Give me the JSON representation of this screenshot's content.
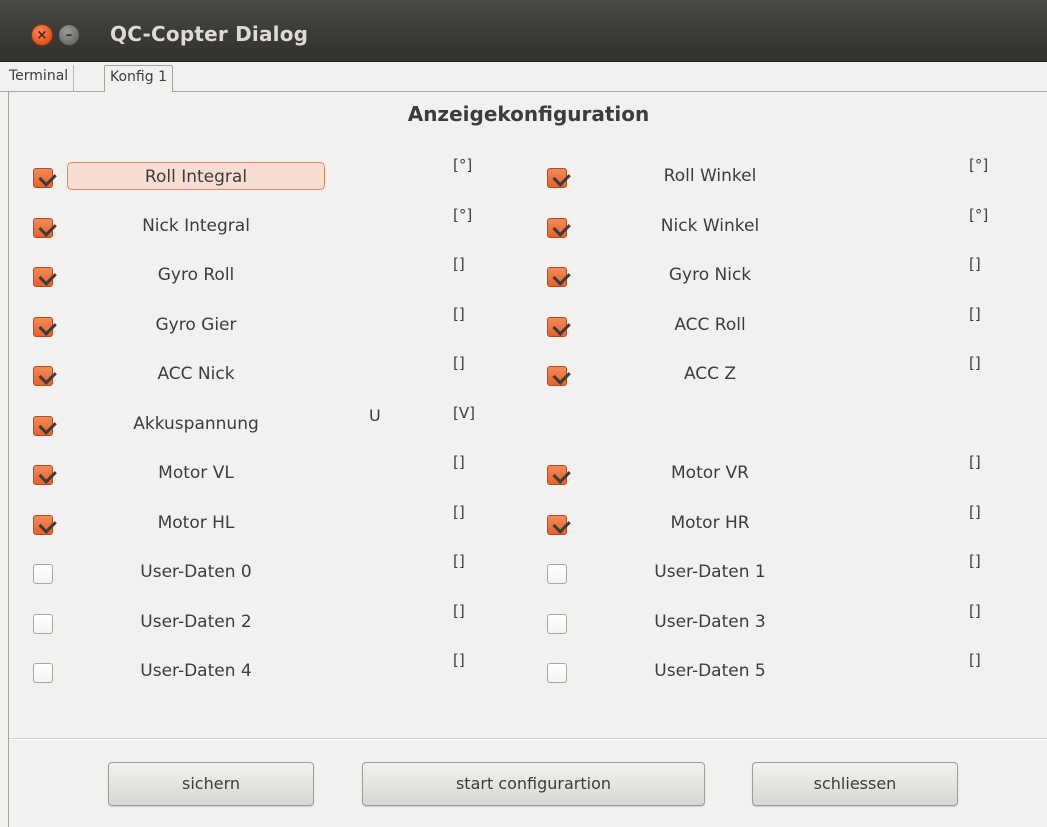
{
  "window": {
    "title": "QC-Copter Dialog"
  },
  "tabs": [
    {
      "label": "Terminal"
    },
    {
      "label": "Konfig 1"
    }
  ],
  "heading": "Anzeigekonfiguration",
  "left_items": [
    {
      "label": "Roll Integral",
      "unit": "[°]",
      "checked": true
    },
    {
      "label": "Nick Integral",
      "unit": "[°]",
      "checked": true
    },
    {
      "label": "Gyro Roll",
      "unit": "[]",
      "checked": true
    },
    {
      "label": "Gyro Gier",
      "unit": "[]",
      "checked": true
    },
    {
      "label": "ACC Nick",
      "unit": "[]",
      "checked": true
    },
    {
      "label": "Akkuspannung",
      "unit": "[V]",
      "value": "U",
      "checked": true
    },
    {
      "label": "Motor VL",
      "unit": "[]",
      "checked": true
    },
    {
      "label": "Motor HL",
      "unit": "[]",
      "checked": true
    },
    {
      "label": "User-Daten 0",
      "unit": "[]",
      "checked": false
    },
    {
      "label": "User-Daten 2",
      "unit": "[]",
      "checked": false
    },
    {
      "label": "User-Daten 4",
      "unit": "[]",
      "checked": false
    }
  ],
  "right_items": [
    {
      "label": "Roll Winkel",
      "unit": "[°]",
      "checked": true
    },
    {
      "label": "Nick Winkel",
      "unit": "[°]",
      "checked": true
    },
    {
      "label": "Gyro Nick",
      "unit": "[]",
      "checked": true
    },
    {
      "label": "ACC Roll",
      "unit": "[]",
      "checked": true
    },
    {
      "label": "ACC Z",
      "unit": "[]",
      "checked": true
    },
    null,
    {
      "label": "Motor VR",
      "unit": "[]",
      "checked": true
    },
    {
      "label": "Motor HR",
      "unit": "[]",
      "checked": true
    },
    {
      "label": "User-Daten 1",
      "unit": "[]",
      "checked": false
    },
    {
      "label": "User-Daten 3",
      "unit": "[]",
      "checked": false
    },
    {
      "label": "User-Daten 5",
      "unit": "[]",
      "checked": false
    }
  ],
  "buttons": {
    "save": "sichern",
    "start": "start configurartion",
    "close": "schliessen"
  },
  "icons": {
    "close": "close-icon",
    "minimize": "minimize-icon"
  },
  "colors": {
    "accent": "#e5622c",
    "titlebar": "#3c3b37"
  }
}
